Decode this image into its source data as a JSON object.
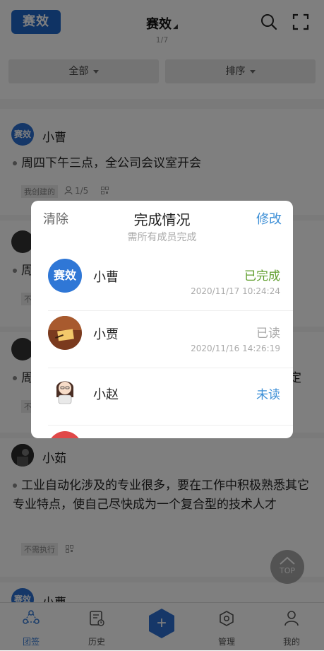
{
  "header": {
    "logo_text": "赛效",
    "title": "赛效",
    "page_indicator": "1/7"
  },
  "filters": {
    "all_label": "全部",
    "sort_label": "排序"
  },
  "feed": [
    {
      "user": "小曹",
      "avatar_text": "赛效",
      "content": "周四下午三点，全公司会议室开会",
      "tag": "我创建的",
      "read_count": "1/5"
    },
    {
      "user": "",
      "content": "周",
      "tag": "不"
    },
    {
      "user": "",
      "content": "周",
      "content_tail": "定",
      "tag": "不"
    },
    {
      "user": "小茹",
      "content": "工业自动化涉及的专业很多，要在工作中积极熟悉其它专业特点，使自己尽快成为一个复合型的技术人才",
      "tag": "不需执行"
    },
    {
      "user": "小曹",
      "avatar_text": "赛效"
    }
  ],
  "modal": {
    "clear_label": "清除",
    "title": "完成情况",
    "edit_label": "修改",
    "subtitle": "需所有成员完成",
    "members": [
      {
        "name": "小曹",
        "avatar_text": "赛效",
        "status": "已完成",
        "time": "2020/11/17 10:24:24"
      },
      {
        "name": "小贾",
        "status": "已读",
        "time": "2020/11/16 14:26:19"
      },
      {
        "name": "小赵",
        "status": "未读",
        "time": ""
      }
    ]
  },
  "top_button_label": "TOP",
  "tabbar": {
    "tabs": [
      {
        "label": "团签",
        "active": true
      },
      {
        "label": "历史",
        "active": false
      },
      {
        "label": "管理",
        "active": false
      },
      {
        "label": "我的",
        "active": false
      }
    ],
    "add_symbol": "+"
  },
  "colors": {
    "brand_blue": "#1e66c9",
    "done_green": "#5f9e2c",
    "unread_blue": "#3d8fd6"
  }
}
